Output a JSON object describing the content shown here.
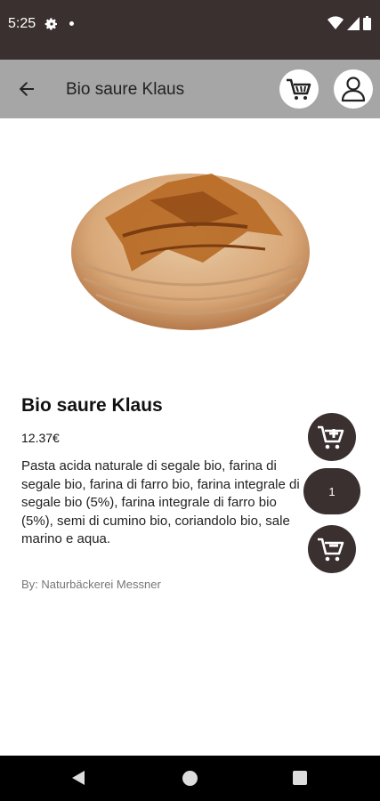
{
  "status_bar": {
    "time": "5:25",
    "icons": [
      "gear-icon",
      "notification-dot-icon",
      "wifi-icon",
      "signal-icon",
      "battery-icon"
    ]
  },
  "app_bar": {
    "title": "Bio saure Klaus",
    "back_icon": "arrow-back-icon",
    "cart_icon": "shopping-cart-icon",
    "profile_icon": "person-icon"
  },
  "product": {
    "image": "bread-loaf-image",
    "name": "Bio saure Klaus",
    "price": "12.37€",
    "description": "Pasta acida naturale di segale bio, farina di segale bio, farina di farro bio, farina integrale di segale bio (5%), farina integrale di farro bio (5%), semi di cumino bio, coriandolo bio, sale marino e aqua.",
    "seller": "By: Naturbäckerei Messner"
  },
  "cart_controls": {
    "add_icon": "cart-plus-icon",
    "quantity": "1",
    "remove_icon": "cart-minus-icon"
  },
  "nav_bar": {
    "icons": [
      "nav-back-icon",
      "nav-home-icon",
      "nav-recents-icon"
    ]
  },
  "colors": {
    "status_bar": "#3a3030",
    "app_bar": "#a6a6a6",
    "button_dark": "#3a3030",
    "nav_bar": "#000000"
  }
}
